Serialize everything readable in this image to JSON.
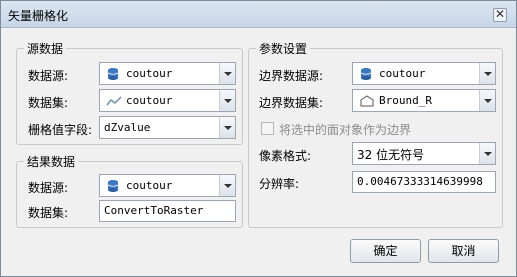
{
  "window": {
    "title": "矢量栅格化",
    "close_symbol": "✕"
  },
  "source": {
    "group_title": "源数据",
    "datasource_label": "数据源:",
    "datasource_value": "coutour",
    "dataset_label": "数据集:",
    "dataset_value": "coutour",
    "field_label": "栅格值字段:",
    "field_value": "dZvalue"
  },
  "result": {
    "group_title": "结果数据",
    "datasource_label": "数据源:",
    "datasource_value": "coutour",
    "dataset_label": "数据集:",
    "dataset_value": "ConvertToRaster"
  },
  "params": {
    "group_title": "参数设置",
    "boundary_source_label": "边界数据源:",
    "boundary_source_value": "coutour",
    "boundary_dataset_label": "边界数据集:",
    "boundary_dataset_value": "Bround_R",
    "use_selection_label": "将选中的面对象作为边界",
    "use_selection_checked": false,
    "pixel_format_label": "像素格式:",
    "pixel_format_value": "32 位无符号",
    "resolution_label": "分辨率:",
    "resolution_value": "0.00467333314639998"
  },
  "buttons": {
    "ok": "确定",
    "cancel": "取消"
  },
  "icons": {
    "datasource": "database-icon",
    "line_dataset": "line-dataset-icon",
    "region_dataset": "region-dataset-icon"
  },
  "colors": {
    "database_icon": "#3a78c2",
    "line_icon": "#6a8fb8"
  }
}
